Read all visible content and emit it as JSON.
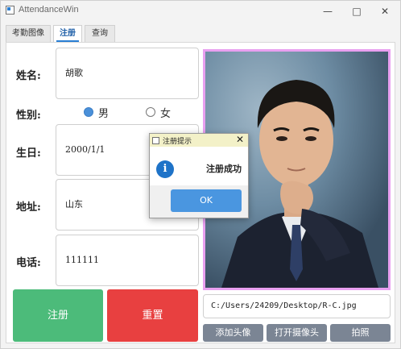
{
  "window": {
    "title": "AttendanceWin",
    "minimize_icon": "minimize-icon",
    "maximize_icon": "maximize-icon",
    "close_icon": "close-icon"
  },
  "tabs": [
    {
      "label": "考勤图像",
      "active": false
    },
    {
      "label": "注册",
      "active": true
    },
    {
      "label": "查询",
      "active": false
    }
  ],
  "form": {
    "name_label": "姓名:",
    "name_value": "胡歌",
    "gender_label": "性别:",
    "gender_options": [
      {
        "label": "男",
        "selected": true
      },
      {
        "label": "女",
        "selected": false
      }
    ],
    "birthday_label": "生日:",
    "birthday_value": "2000/1/1",
    "address_label": "地址:",
    "address_value": "山东",
    "phone_label": "电话:",
    "phone_value": "111111"
  },
  "actions": {
    "register_label": "注册",
    "reset_label": "重置",
    "register_color": "#4cbb7a",
    "reset_color": "#e84040"
  },
  "photo": {
    "path_value": "C:/Users/24209/Desktop/R-C.jpg",
    "border_color": "#e9a0f0"
  },
  "photo_buttons": {
    "add_avatar": "添加头像",
    "open_camera": "打开摄像头",
    "take_photo": "拍照"
  },
  "dialog": {
    "title": "注册提示",
    "message": "注册成功",
    "ok_label": "OK",
    "icon": "info-icon"
  }
}
